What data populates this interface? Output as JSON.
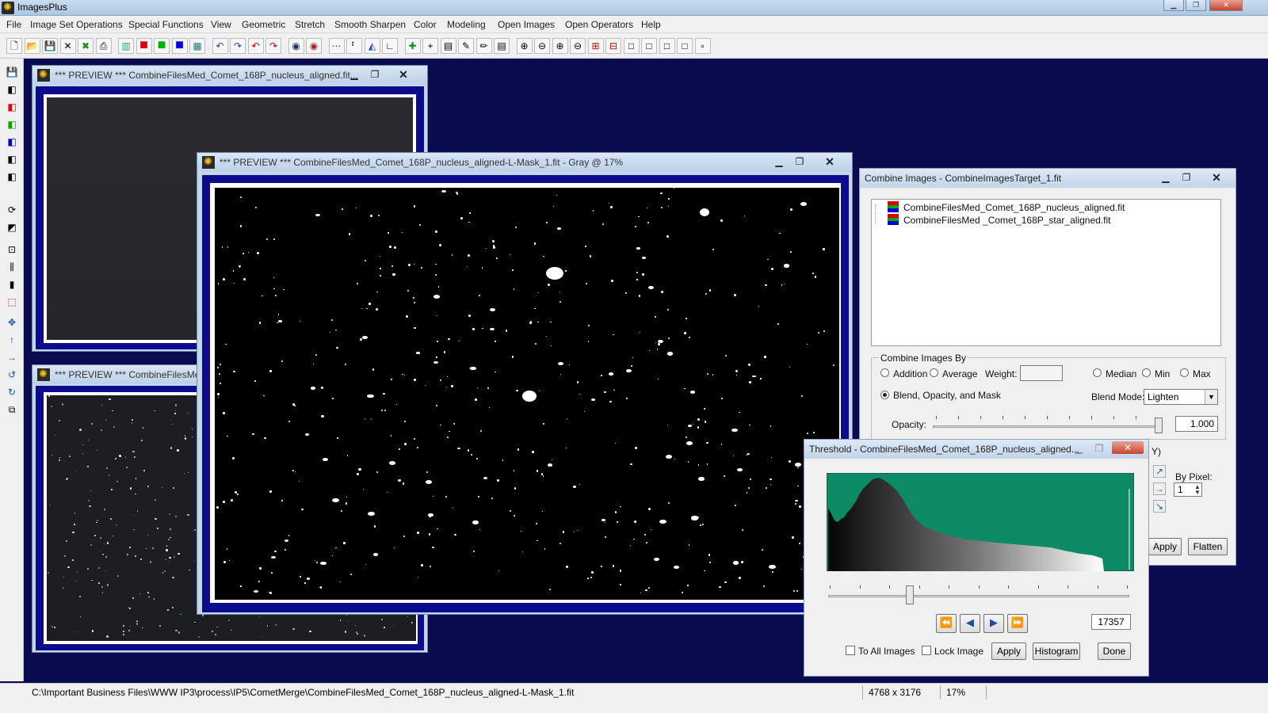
{
  "app": {
    "title": "ImagesPlus"
  },
  "menu": [
    "File",
    "Image Set Operations",
    "Special Functions",
    "View",
    "Geometric",
    "Stretch",
    "Smooth Sharpen",
    "Color",
    "Modeling",
    "Open Images",
    "Open Operators",
    "Help"
  ],
  "toolbar_icons": [
    "new-icon",
    "open-icon",
    "save-icon",
    "close-icon",
    "close-all-icon",
    "print-icon",
    "rgb-icon",
    "red-channel-icon",
    "green-channel-icon",
    "blue-channel-icon",
    "grid-icon",
    "undo-icon",
    "redo-icon",
    "undo-all-icon",
    "redo-all-icon",
    "circle-icon",
    "dot-icon",
    "dotted-line-icon",
    "pixel-icon",
    "chart-icon",
    "axes-icon",
    "crosshair-icon",
    "cross-icon",
    "calculator-icon",
    "palette-icon",
    "pencil-icon",
    "table-icon",
    "zoom-in-icon",
    "zoom-out-icon",
    "zoom-fit-icon",
    "zoom-actual-icon",
    "plus-box-icon",
    "minus-box-icon",
    "rect1-icon",
    "rect2-icon",
    "rect3-icon",
    "rect4-icon",
    "rect5-icon"
  ],
  "windows": {
    "preview1": {
      "title": "*** PREVIEW *** CombineFilesMed_Comet_168P_nucleus_aligned.fit..."
    },
    "preview2": {
      "title": "*** PREVIEW *** CombineFilesMed"
    },
    "preview_mask": {
      "title": "*** PREVIEW *** CombineFilesMed_Comet_168P_nucleus_aligned-L-Mask_1.fit - Gray @ 17%"
    }
  },
  "combine": {
    "title": "Combine Images - CombineImagesTarget_1.fit",
    "files": [
      "CombineFilesMed_Comet_168P_nucleus_aligned.fit",
      "CombineFilesMed _Comet_168P_star_aligned.fit"
    ],
    "group_label": "Combine Images By",
    "options": {
      "addition": "Addition",
      "average": "Average",
      "weight": "Weight:",
      "median": "Median",
      "min": "Min",
      "max": "Max",
      "blend": "Blend, Opacity, and Mask"
    },
    "blend_mode_label": "Blend Mode:",
    "blend_mode_value": "Lighten",
    "opacity_label": "Opacity:",
    "opacity_value": "1.000",
    "partial_text": "Y)",
    "by_pixel_label": "By Pixel:",
    "by_pixel_value": "1",
    "apply": "Apply",
    "flatten": "Flatten"
  },
  "threshold": {
    "title": "Threshold - CombineFilesMed_Comet_168P_nucleus_aligned...",
    "value": "17357",
    "slider_fraction": 0.27,
    "to_all_images": "To All Images",
    "lock_image": "Lock Image",
    "apply": "Apply",
    "histogram": "Histogram",
    "done": "Done"
  },
  "status": {
    "path": "C:\\Important Business Files\\WWW IP3\\process\\IP5\\CometMerge\\CombineFilesMed_Comet_168P_nucleus_aligned-L-Mask_1.fit",
    "dimensions": "4768 x 3176",
    "zoom": "17%"
  },
  "colors": {
    "desktop": "#0a0a4e",
    "frame_blue": "#0b0b8c",
    "histogram_bg": "#0b8a63"
  }
}
